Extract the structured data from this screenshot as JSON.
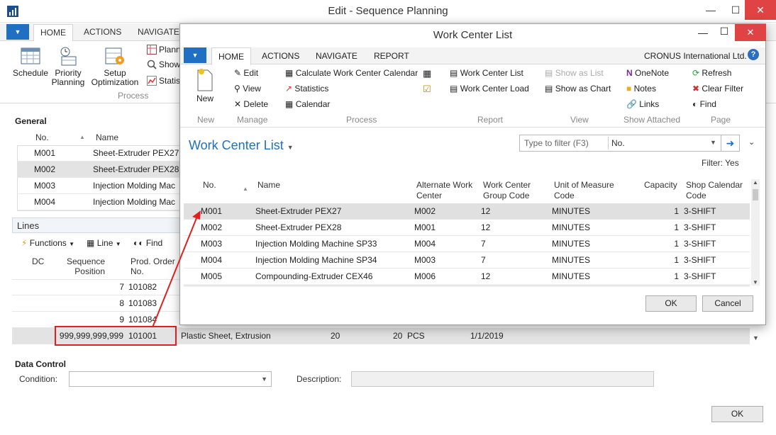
{
  "window": {
    "title": "Edit - Sequence Planning"
  },
  "tabs": [
    "HOME",
    "ACTIONS",
    "NAVIGATE"
  ],
  "ribbon": {
    "schedule": "Schedule",
    "priority_planning": [
      "Priority",
      "Planning"
    ],
    "setup_optimization": [
      "Setup",
      "Optimization"
    ],
    "planning_trunc": "Plann",
    "show_trunc": "Show",
    "statistics_trunc": "Statis",
    "group_process": "Process"
  },
  "general": {
    "title": "General",
    "col_no": "No.",
    "col_name": "Name",
    "rows": [
      {
        "no": "M001",
        "name": "Sheet-Extruder PEX27",
        "selected": false
      },
      {
        "no": "M002",
        "name": "Sheet-Extruder PEX28",
        "selected": true
      },
      {
        "no": "M003",
        "name": "Injection Molding Mac",
        "selected": false
      },
      {
        "no": "M004",
        "name": "Injection Molding Mac",
        "selected": false
      }
    ]
  },
  "lines": {
    "title": "Lines",
    "functions": "Functions",
    "line": "Line",
    "find": "Find",
    "col_dc": "DC",
    "col_seq": [
      "Sequence",
      "Position"
    ],
    "col_prod": [
      "Prod. Order",
      "No."
    ],
    "rows": [
      {
        "seq": "7",
        "order": "101082"
      },
      {
        "seq": "8",
        "order": "101083"
      },
      {
        "seq": "9",
        "order": "101084"
      }
    ],
    "highlight_row": {
      "seq": "999,999,999,999",
      "order": "101001",
      "desc": "Plastic Sheet, Extrusion",
      "qty1": "20",
      "qty2": "20",
      "uom": "PCS",
      "date": "1/1/2019"
    }
  },
  "data_control": {
    "title": "Data Control",
    "condition_label": "Condition:",
    "description_label": "Description:"
  },
  "ok_button": "OK",
  "modal": {
    "title": "Work Center List",
    "tabs": [
      "HOME",
      "ACTIONS",
      "NAVIGATE",
      "REPORT"
    ],
    "company": "CRONUS International Ltd.",
    "ribbon": {
      "new": "New",
      "edit": "Edit",
      "view": "View",
      "delete": "Delete",
      "calc_cal": "Calculate Work Center Calendar",
      "statistics": "Statistics",
      "calendar": "Calendar",
      "wc_list": "Work Center List",
      "wc_load": "Work Center Load",
      "show_list": "Show as List",
      "show_chart": "Show as Chart",
      "onenote": "OneNote",
      "notes": "Notes",
      "links": "Links",
      "refresh": "Refresh",
      "clear_filter": "Clear Filter",
      "find": "Find",
      "groups": [
        "New",
        "Manage",
        "Process",
        "Report",
        "View",
        "Show Attached",
        "Page"
      ]
    },
    "list_title": "Work Center List",
    "filter_placeholder": "Type to filter (F3)",
    "filter_field": "No.",
    "filter_status": "Filter: Yes",
    "columns": {
      "no": "No.",
      "name": "Name",
      "alt": [
        "Alternate Work",
        "Center"
      ],
      "group": [
        "Work Center",
        "Group Code"
      ],
      "uom": [
        "Unit of Measure",
        "Code"
      ],
      "capacity": "Capacity",
      "shop": [
        "Shop Calendar",
        "Code"
      ]
    },
    "rows": [
      {
        "no": "M001",
        "name": "Sheet-Extruder PEX27",
        "alt": "M002",
        "group": "12",
        "uom": "MINUTES",
        "cap": "1",
        "shop": "3-SHIFT",
        "selected": true
      },
      {
        "no": "M002",
        "name": "Sheet-Extruder PEX28",
        "alt": "M001",
        "group": "12",
        "uom": "MINUTES",
        "cap": "1",
        "shop": "3-SHIFT",
        "selected": false
      },
      {
        "no": "M003",
        "name": "Injection Molding Machine SP33",
        "alt": "M004",
        "group": "7",
        "uom": "MINUTES",
        "cap": "1",
        "shop": "3-SHIFT",
        "selected": false
      },
      {
        "no": "M004",
        "name": "Injection Molding Machine SP34",
        "alt": "M003",
        "group": "7",
        "uom": "MINUTES",
        "cap": "1",
        "shop": "3-SHIFT",
        "selected": false
      },
      {
        "no": "M005",
        "name": "Compounding-Extruder CEX46",
        "alt": "M006",
        "group": "12",
        "uom": "MINUTES",
        "cap": "1",
        "shop": "3-SHIFT",
        "selected": false
      }
    ],
    "ok": "OK",
    "cancel": "Cancel"
  },
  "colors": {
    "accent": "#1f6fc2",
    "close": "#e04343",
    "annotation": "#e02020"
  }
}
